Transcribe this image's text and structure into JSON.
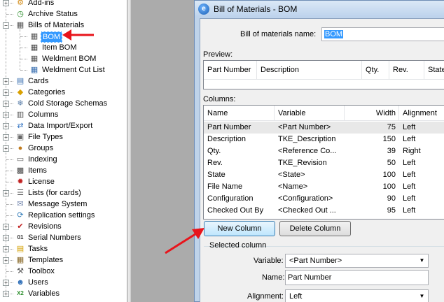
{
  "tree": {
    "items": [
      {
        "label": "Add-ins",
        "icon": "add-ins-icon",
        "glyph": "⚙",
        "color": "#d28a14",
        "expandable": true
      },
      {
        "label": "Archive Status",
        "icon": "archive-status-icon",
        "glyph": "◷",
        "color": "#2f8f2f",
        "expandable": false
      },
      {
        "label": "Bills of Materials",
        "icon": "bom-folder-icon",
        "glyph": "▦",
        "color": "#555555",
        "expandable": true
      },
      {
        "label": "BOM",
        "icon": "bom-grid-icon",
        "glyph": "▦",
        "color": "#555555",
        "child": true,
        "selected": true
      },
      {
        "label": "Item BOM",
        "icon": "item-bom-icon",
        "glyph": "▦",
        "color": "#444444",
        "child": true
      },
      {
        "label": "Weldment BOM",
        "icon": "weldment-bom-icon",
        "glyph": "▦",
        "color": "#555555",
        "child": true
      },
      {
        "label": "Weldment Cut List",
        "icon": "weldment-cut-list-icon",
        "glyph": "▦",
        "color": "#3a6fb0",
        "child": true
      },
      {
        "label": "Cards",
        "icon": "cards-icon",
        "glyph": "▤",
        "color": "#3a6fb0",
        "expandable": true
      },
      {
        "label": "Categories",
        "icon": "categories-icon",
        "glyph": "◆",
        "color": "#d9a000",
        "expandable": true
      },
      {
        "label": "Cold Storage Schemas",
        "icon": "cold-storage-icon",
        "glyph": "❄",
        "color": "#5a7ea8",
        "expandable": true
      },
      {
        "label": "Columns",
        "icon": "columns-icon",
        "glyph": "▥",
        "color": "#555555",
        "expandable": true
      },
      {
        "label": "Data Import/Export",
        "icon": "data-import-export-icon",
        "glyph": "⇄",
        "color": "#2c6fc0",
        "expandable": true
      },
      {
        "label": "File Types",
        "icon": "file-types-icon",
        "glyph": "▣",
        "color": "#666666",
        "expandable": true
      },
      {
        "label": "Groups",
        "icon": "groups-icon",
        "glyph": "●",
        "color": "#c07a1c",
        "expandable": true
      },
      {
        "label": "Indexing",
        "icon": "indexing-icon",
        "glyph": "▭",
        "color": "#666666",
        "expandable": false
      },
      {
        "label": "Items",
        "icon": "items-icon",
        "glyph": "▩",
        "color": "#444444",
        "expandable": false
      },
      {
        "label": "License",
        "icon": "license-icon",
        "glyph": "✹",
        "color": "#c02020",
        "expandable": false
      },
      {
        "label": "Lists (for cards)",
        "icon": "lists-icon",
        "glyph": "☰",
        "color": "#555555",
        "expandable": true
      },
      {
        "label": "Message System",
        "icon": "message-system-icon",
        "glyph": "✉",
        "color": "#6b7fa8",
        "expandable": false
      },
      {
        "label": "Replication settings",
        "icon": "replication-settings-icon",
        "glyph": "⟳",
        "color": "#2f7ab8",
        "expandable": false
      },
      {
        "label": "Revisions",
        "icon": "revisions-icon",
        "glyph": "✔",
        "color": "#c02020",
        "expandable": true
      },
      {
        "label": "Serial Numbers",
        "icon": "serial-numbers-icon",
        "glyph": "01",
        "color": "#333333",
        "expandable": true
      },
      {
        "label": "Tasks",
        "icon": "tasks-icon",
        "glyph": "▤",
        "color": "#d4a000",
        "expandable": true
      },
      {
        "label": "Templates",
        "icon": "templates-icon",
        "glyph": "▦",
        "color": "#8a6a2a",
        "expandable": true
      },
      {
        "label": "Toolbox",
        "icon": "toolbox-icon",
        "glyph": "⚒",
        "color": "#555555",
        "expandable": false
      },
      {
        "label": "Users",
        "icon": "users-icon",
        "glyph": "☻",
        "color": "#2f6fb8",
        "expandable": true
      },
      {
        "label": "Variables",
        "icon": "variables-icon",
        "glyph": "X2",
        "color": "#2f8f2f",
        "expandable": true
      }
    ]
  },
  "dialog": {
    "title": "Bill of Materials - BOM",
    "bom_name_label": "Bill of materials name:",
    "bom_name_value": "BOM",
    "preview_label": "Preview:",
    "preview_columns": [
      "Part Number",
      "Description",
      "Qty.",
      "Rev.",
      "State"
    ],
    "columns_label": "Columns:",
    "columns_headers": [
      "Name",
      "Variable",
      "Width",
      "Alignment"
    ],
    "columns_rows": [
      {
        "name": "Part Number",
        "variable": "<Part Number>",
        "width": "75",
        "alignment": "Left"
      },
      {
        "name": "Description",
        "variable": "TKE_Description",
        "width": "150",
        "alignment": "Left"
      },
      {
        "name": "Qty.",
        "variable": "<Reference Co...",
        "width": "39",
        "alignment": "Right"
      },
      {
        "name": "Rev.",
        "variable": "TKE_Revision",
        "width": "50",
        "alignment": "Left"
      },
      {
        "name": "State",
        "variable": "<State>",
        "width": "100",
        "alignment": "Left"
      },
      {
        "name": "File Name",
        "variable": "<Name>",
        "width": "100",
        "alignment": "Left"
      },
      {
        "name": "Configuration",
        "variable": "<Configuration>",
        "width": "90",
        "alignment": "Left"
      },
      {
        "name": "Checked Out By",
        "variable": "<Checked Out ...",
        "width": "95",
        "alignment": "Left"
      }
    ],
    "new_column_label": "New Column",
    "delete_column_label": "Delete Column",
    "selected_column_label": "Selected column",
    "variable_label": "Variable:",
    "variable_value": "<Part Number>",
    "name_label": "Name:",
    "name_value": "Part Number",
    "alignment_label": "Alignment:",
    "alignment_value": "Left"
  },
  "colors": {
    "selection": "#3399ff",
    "arrow": "#e8141b"
  }
}
